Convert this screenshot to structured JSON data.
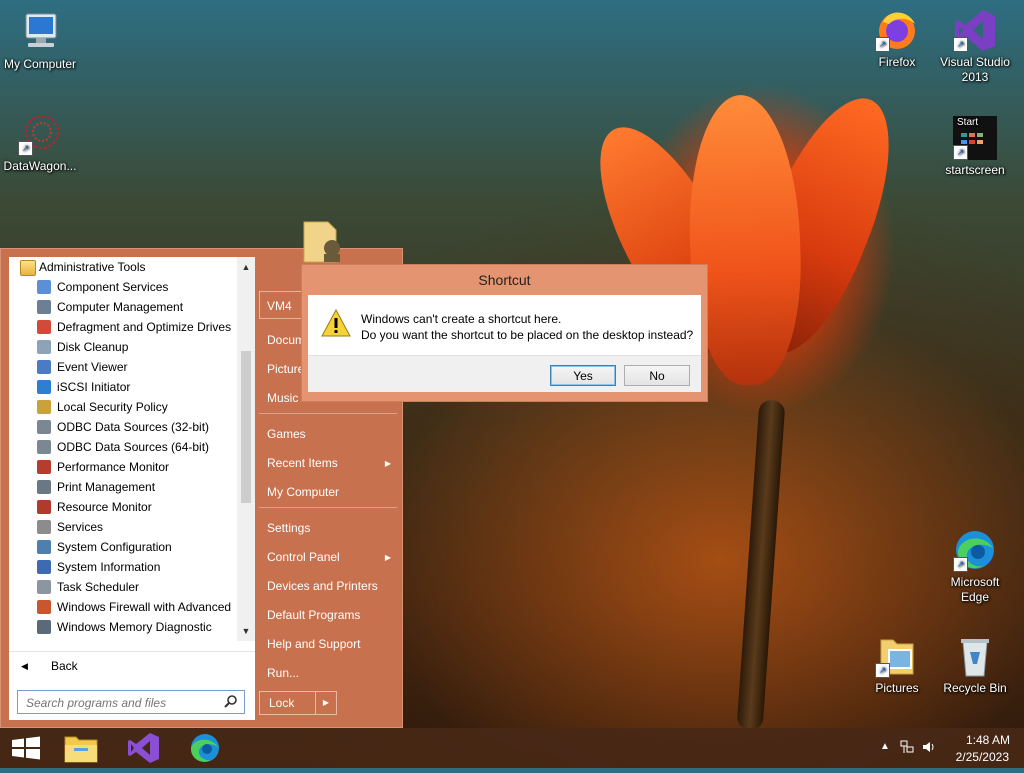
{
  "desktop": {
    "icons": [
      {
        "label": "My Computer"
      },
      {
        "label": "DataWagon..."
      },
      {
        "label": "Firefox"
      },
      {
        "label": "Visual Studio 2013"
      },
      {
        "label": "startscreen",
        "tile_text": "Start"
      },
      {
        "label": "Microsoft Edge"
      },
      {
        "label": "Pictures"
      },
      {
        "label": "Recycle Bin"
      }
    ]
  },
  "start_menu": {
    "programs": [
      {
        "label": "Administrative Tools",
        "icon": "folder-icon"
      },
      {
        "label": "Component Services",
        "icon": "component-services-icon"
      },
      {
        "label": "Computer Management",
        "icon": "computer-management-icon"
      },
      {
        "label": "Defragment and Optimize Drives",
        "icon": "defragment-icon"
      },
      {
        "label": "Disk Cleanup",
        "icon": "disk-cleanup-icon"
      },
      {
        "label": "Event Viewer",
        "icon": "event-viewer-icon"
      },
      {
        "label": "iSCSI Initiator",
        "icon": "iscsi-icon"
      },
      {
        "label": "Local Security Policy",
        "icon": "security-policy-icon"
      },
      {
        "label": "ODBC Data Sources (32-bit)",
        "icon": "odbc-icon"
      },
      {
        "label": "ODBC Data Sources (64-bit)",
        "icon": "odbc-icon"
      },
      {
        "label": "Performance Monitor",
        "icon": "performance-monitor-icon"
      },
      {
        "label": "Print Management",
        "icon": "print-management-icon"
      },
      {
        "label": "Resource Monitor",
        "icon": "resource-monitor-icon"
      },
      {
        "label": "Services",
        "icon": "services-icon"
      },
      {
        "label": "System Configuration",
        "icon": "system-configuration-icon"
      },
      {
        "label": "System Information",
        "icon": "system-information-icon"
      },
      {
        "label": "Task Scheduler",
        "icon": "task-scheduler-icon"
      },
      {
        "label": "Windows Firewall with Advanced",
        "icon": "firewall-icon"
      },
      {
        "label": "Windows Memory Diagnostic",
        "icon": "memory-diagnostic-icon"
      }
    ],
    "back_label": "Back",
    "search_placeholder": "Search programs and files",
    "user_name": "VM4",
    "right_items": [
      {
        "label": "Documents",
        "submenu": false
      },
      {
        "label": "Pictures",
        "submenu": false
      },
      {
        "label": "Music",
        "submenu": false
      },
      {
        "label": "Games",
        "submenu": false
      },
      {
        "label": "Recent Items",
        "submenu": true
      },
      {
        "label": "My Computer",
        "submenu": false
      },
      {
        "label": "Settings",
        "submenu": false
      },
      {
        "label": "Control Panel",
        "submenu": true
      },
      {
        "label": "Devices and Printers",
        "submenu": false
      },
      {
        "label": "Default Programs",
        "submenu": false
      },
      {
        "label": "Help and Support",
        "submenu": false
      },
      {
        "label": "Run...",
        "submenu": false
      }
    ],
    "lock_label": "Lock"
  },
  "dialog": {
    "title": "Shortcut",
    "message_line1": "Windows can't create a shortcut here.",
    "message_line2": "Do you want the shortcut to be placed on the desktop instead?",
    "yes_label": "Yes",
    "no_label": "No"
  },
  "taskbar": {
    "pinned": [
      "windows-start-icon",
      "file-explorer-icon",
      "visual-studio-icon",
      "edge-icon"
    ],
    "clock_time": "1:48 AM",
    "clock_date": "2/25/2023"
  },
  "colors": {
    "start_menu_bg": "#c8714e",
    "dialog_frame": "#e49471",
    "taskbar_bg": "#48281a"
  }
}
